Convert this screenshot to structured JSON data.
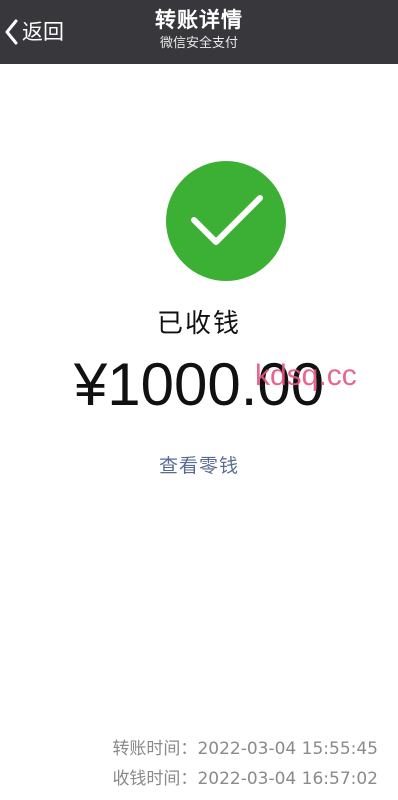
{
  "header": {
    "back_label": "返回",
    "title": "转账详情",
    "subtitle": "微信安全支付",
    "background": "#38383c"
  },
  "status": {
    "icon": "check-circle-icon",
    "icon_color": "#3cb034",
    "text": "已收钱"
  },
  "amount": {
    "value": "¥1000.00"
  },
  "watermark": {
    "text": "kdsq.cc",
    "color": "#e4577f"
  },
  "links": {
    "view_change": "查看零钱",
    "color": "#576b95"
  },
  "details": [
    {
      "label": "转账时间：",
      "value": "2022-03-04 15:55:45"
    },
    {
      "label": "收钱时间：",
      "value": "2022-03-04 16:57:02"
    }
  ]
}
